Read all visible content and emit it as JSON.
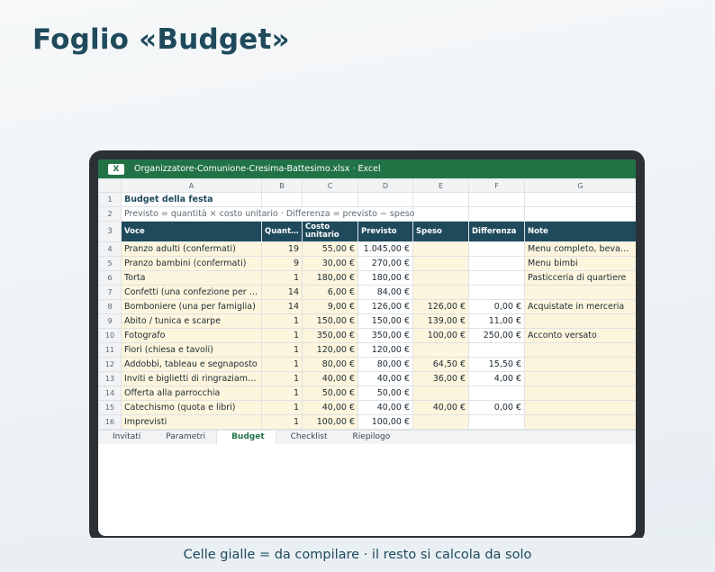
{
  "page": {
    "title": "Foglio «Budget»",
    "caption": "Celle gialle = da compilare · il resto si calcola da solo"
  },
  "window": {
    "badge": "X",
    "title": "Organizzatore-Comunione-Cresima-Battesimo.xlsx · Excel"
  },
  "colors": {
    "excel_green": "#217346",
    "header_navy": "#1e4a5c",
    "input_yellow": "#fdf5dd"
  },
  "sheet": {
    "columns": [
      "A",
      "B",
      "C",
      "D",
      "E",
      "F",
      "G"
    ],
    "title_row": {
      "num": "1",
      "text": "Budget della festa"
    },
    "subtitle_row": {
      "num": "2",
      "text": "Previsto = quantità × costo unitario · Differenza = previsto − speso"
    },
    "header_row": {
      "num": "3",
      "voce": "Voce",
      "quantita": "Quantità",
      "costo": "Costo unitario",
      "previsto": "Previsto",
      "speso": "Speso",
      "differenza": "Differenza",
      "note": "Note"
    },
    "rows": [
      {
        "num": "4",
        "voce": "Pranzo adulti (confermati)",
        "quantita": "19",
        "costo": "55,00 €",
        "previsto": "1.045,00 €",
        "speso": "",
        "differenza": "",
        "note": "Menu completo, bevande incluse"
      },
      {
        "num": "5",
        "voce": "Pranzo bambini (confermati)",
        "quantita": "9",
        "costo": "30,00 €",
        "previsto": "270,00 €",
        "speso": "",
        "differenza": "",
        "note": "Menu bimbi"
      },
      {
        "num": "6",
        "voce": "Torta",
        "quantita": "1",
        "costo": "180,00 €",
        "previsto": "180,00 €",
        "speso": "",
        "differenza": "",
        "note": "Pasticceria di quartiere"
      },
      {
        "num": "7",
        "voce": "Confetti (una confezione per famiglia)",
        "quantita": "14",
        "costo": "6,00 €",
        "previsto": "84,00 €",
        "speso": "",
        "differenza": "",
        "note": ""
      },
      {
        "num": "8",
        "voce": "Bomboniere (una per famiglia)",
        "quantita": "14",
        "costo": "9,00 €",
        "previsto": "126,00 €",
        "speso": "126,00 €",
        "differenza": "0,00 €",
        "note": "Acquistate in merceria"
      },
      {
        "num": "9",
        "voce": "Abito / tunica e scarpe",
        "quantita": "1",
        "costo": "150,00 €",
        "previsto": "150,00 €",
        "speso": "139,00 €",
        "differenza": "11,00 €",
        "note": ""
      },
      {
        "num": "10",
        "voce": "Fotografo",
        "quantita": "1",
        "costo": "350,00 €",
        "previsto": "350,00 €",
        "speso": "100,00 €",
        "differenza": "250,00 €",
        "note": "Acconto versato"
      },
      {
        "num": "11",
        "voce": "Fiori (chiesa e tavoli)",
        "quantita": "1",
        "costo": "120,00 €",
        "previsto": "120,00 €",
        "speso": "",
        "differenza": "",
        "note": ""
      },
      {
        "num": "12",
        "voce": "Addobbi, tableau e segnaposto",
        "quantita": "1",
        "costo": "80,00 €",
        "previsto": "80,00 €",
        "speso": "64,50 €",
        "differenza": "15,50 €",
        "note": ""
      },
      {
        "num": "13",
        "voce": "Inviti e biglietti di ringraziamento",
        "quantita": "1",
        "costo": "40,00 €",
        "previsto": "40,00 €",
        "speso": "36,00 €",
        "differenza": "4,00 €",
        "note": ""
      },
      {
        "num": "14",
        "voce": "Offerta alla parrocchia",
        "quantita": "1",
        "costo": "50,00 €",
        "previsto": "50,00 €",
        "speso": "",
        "differenza": "",
        "note": ""
      },
      {
        "num": "15",
        "voce": "Catechismo (quota e libri)",
        "quantita": "1",
        "costo": "40,00 €",
        "previsto": "40,00 €",
        "speso": "40,00 €",
        "differenza": "0,00 €",
        "note": ""
      },
      {
        "num": "16",
        "voce": "Imprevisti",
        "quantita": "1",
        "costo": "100,00 €",
        "previsto": "100,00 €",
        "speso": "",
        "differenza": "",
        "note": ""
      }
    ],
    "tabs": [
      {
        "label": "Invitati",
        "active": false
      },
      {
        "label": "Parametri",
        "active": false
      },
      {
        "label": "Budget",
        "active": true
      },
      {
        "label": "Checklist",
        "active": false
      },
      {
        "label": "Riepilogo",
        "active": false
      }
    ]
  }
}
